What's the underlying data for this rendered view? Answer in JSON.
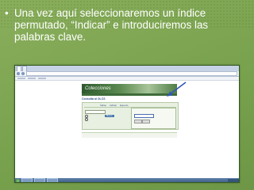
{
  "slide": {
    "bullet_symbol": "•",
    "bullet_text": "Una vez aquí seleccionaremos un índice permutado, “Indicar” e introduciremos las palabras clave.",
    "colors": {
      "background": "#7da64f",
      "text": "#ffffff",
      "arrow": "#2f57b8"
    }
  },
  "screenshot": {
    "browser": {
      "tabs": [
        "",
        ""
      ]
    },
    "page": {
      "banner_text": "Colecciones",
      "consulta_title": "Consulta al OLCS",
      "query_tabs": [
        "Índice",
        "Indicar",
        "Experto"
      ],
      "buttons": {
        "buscar": "Buscar"
      },
      "radios": [
        "",
        ""
      ]
    }
  }
}
